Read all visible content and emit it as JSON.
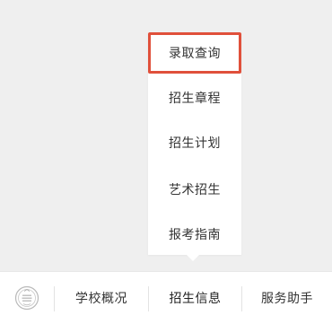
{
  "submenu": {
    "items": [
      {
        "label": "录取查询",
        "selected": true
      },
      {
        "label": "招生章程",
        "selected": false
      },
      {
        "label": "招生计划",
        "selected": false
      },
      {
        "label": "艺术招生",
        "selected": false
      },
      {
        "label": "报考指南",
        "selected": false
      }
    ]
  },
  "tabbar": {
    "home_icon": "school-emblem-icon",
    "tabs": [
      {
        "label": "学校概况"
      },
      {
        "label": "招生信息",
        "active": true
      },
      {
        "label": "服务助手"
      }
    ]
  },
  "colors": {
    "selected_border": "#e0503b",
    "background": "#efefef",
    "text": "#333333"
  }
}
